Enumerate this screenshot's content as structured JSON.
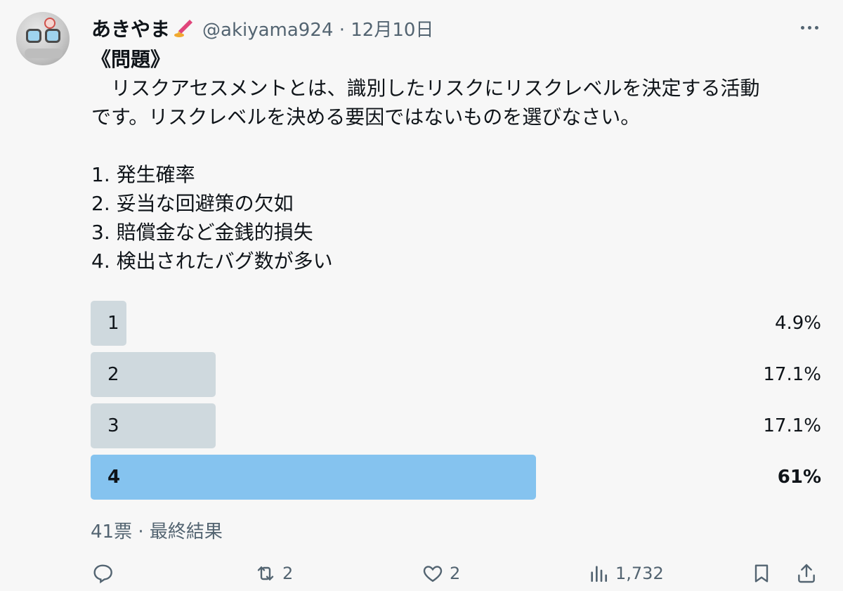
{
  "author": {
    "display_name": "あきやま",
    "handle": "@akiyama924",
    "date": "12月10日",
    "separator": "·"
  },
  "tweet": {
    "title": "《問題》",
    "lines": [
      "　リスクアセスメントとは、識別したリスクにリスクレベルを決定する活動",
      "です。リスクレベルを決める要因ではないものを選びなさい。"
    ],
    "options": [
      "1. 発生確率",
      "2. 妥当な回避策の欠如",
      "3. 賠償金など金銭的損失",
      "4. 検出されたバグ数が多い"
    ]
  },
  "poll": {
    "choices": [
      {
        "label": "1",
        "percent_text": "4.9%",
        "percent": 4.9
      },
      {
        "label": "2",
        "percent_text": "17.1%",
        "percent": 17.1
      },
      {
        "label": "3",
        "percent_text": "17.1%",
        "percent": 17.1
      },
      {
        "label": "4",
        "percent_text": "61%",
        "percent": 61,
        "winner": true
      }
    ],
    "summary": "41票 · 最終結果"
  },
  "actions": {
    "reply_count": "",
    "retweet_count": "2",
    "like_count": "2",
    "views_count": "1,732"
  },
  "icons": {
    "more": "more-dots-icon",
    "reply": "reply-icon",
    "retweet": "retweet-icon",
    "like": "heart-icon",
    "views": "views-chart-icon",
    "bookmark": "bookmark-icon",
    "share": "share-icon",
    "name_emoji": "pen-emoji-icon"
  },
  "colors": {
    "poll_bar": "#cfd9de",
    "poll_winner": "#85c3ef",
    "secondary_text": "#536471"
  }
}
